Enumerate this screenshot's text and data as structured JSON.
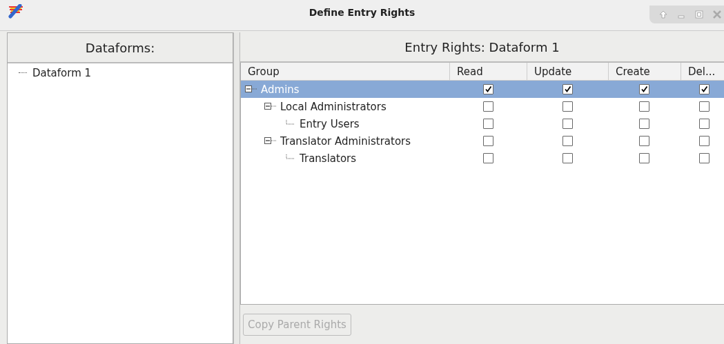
{
  "window": {
    "title": "Define Entry Rights"
  },
  "dataforms": {
    "title": "Dataforms:",
    "items": [
      {
        "label": "Dataform 1",
        "selected": false
      }
    ]
  },
  "rights": {
    "title": "Entry Rights: Dataform 1",
    "columns": [
      "Group",
      "Read",
      "Update",
      "Create",
      "Del..."
    ],
    "rows": [
      {
        "label": "Admins",
        "selected": true,
        "expanded": true,
        "rights": [
          true,
          true,
          true,
          true
        ],
        "children": [
          {
            "label": "Local Administrators",
            "selected": false,
            "expanded": true,
            "rights": [
              false,
              false,
              false,
              false
            ],
            "children": [
              {
                "label": "Entry Users",
                "selected": false,
                "rights": [
                  false,
                  false,
                  false,
                  false
                ]
              }
            ]
          },
          {
            "label": "Translator Administrators",
            "selected": false,
            "expanded": true,
            "rights": [
              false,
              false,
              false,
              false
            ],
            "children": [
              {
                "label": "Translators",
                "selected": false,
                "rights": [
                  false,
                  false,
                  false,
                  false
                ]
              }
            ]
          }
        ]
      }
    ]
  },
  "buttons": [
    {
      "label": "Copy Parent Rights",
      "disabled": true
    }
  ]
}
